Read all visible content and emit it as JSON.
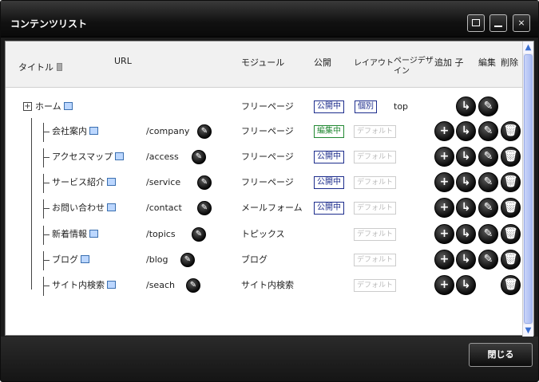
{
  "window": {
    "title": "コンテンツリスト"
  },
  "header": {
    "title": "タイトル",
    "url": "URL",
    "module": "モジュール",
    "public": "公開",
    "layout": "レイアウト",
    "page_design": "ページデザイン",
    "add_child": "追加 子",
    "edit": "編集",
    "delete": "削除"
  },
  "rows": [
    {
      "title": "ホーム",
      "url": "",
      "module": "フリーページ",
      "status": "公開中",
      "layout": "個別",
      "design": "top",
      "actions": [
        "add-child",
        "edit"
      ]
    },
    {
      "title": "会社案内",
      "url": "/company",
      "module": "フリーページ",
      "status": "編集中",
      "layout": "デフォルト",
      "design": "",
      "actions": [
        "add",
        "add-child",
        "edit",
        "delete"
      ]
    },
    {
      "title": "アクセスマップ",
      "url": "/access",
      "module": "フリーページ",
      "status": "公開中",
      "layout": "デフォルト",
      "design": "",
      "actions": [
        "add",
        "add-child",
        "edit",
        "delete"
      ]
    },
    {
      "title": "サービス紹介",
      "url": "/service",
      "module": "フリーページ",
      "status": "公開中",
      "layout": "デフォルト",
      "design": "",
      "actions": [
        "add",
        "add-child",
        "edit",
        "delete"
      ]
    },
    {
      "title": "お問い合わせ",
      "url": "/contact",
      "module": "メールフォーム",
      "status": "公開中",
      "layout": "デフォルト",
      "design": "",
      "actions": [
        "add",
        "add-child",
        "edit",
        "delete"
      ]
    },
    {
      "title": "新着情報",
      "url": "/topics",
      "module": "トピックス",
      "status": "",
      "layout": "デフォルト",
      "design": "",
      "actions": [
        "add",
        "add-child",
        "edit",
        "delete"
      ]
    },
    {
      "title": "ブログ",
      "url": "/blog",
      "module": "ブログ",
      "status": "",
      "layout": "デフォルト",
      "design": "",
      "actions": [
        "add",
        "add-child",
        "edit",
        "delete"
      ]
    },
    {
      "title": "サイト内検索",
      "url": "/seach",
      "module": "サイト内検索",
      "status": "",
      "layout": "デフォルト",
      "design": "",
      "actions": [
        "add",
        "add-child",
        "delete"
      ]
    }
  ],
  "footer": {
    "close_label": "閉じる"
  }
}
